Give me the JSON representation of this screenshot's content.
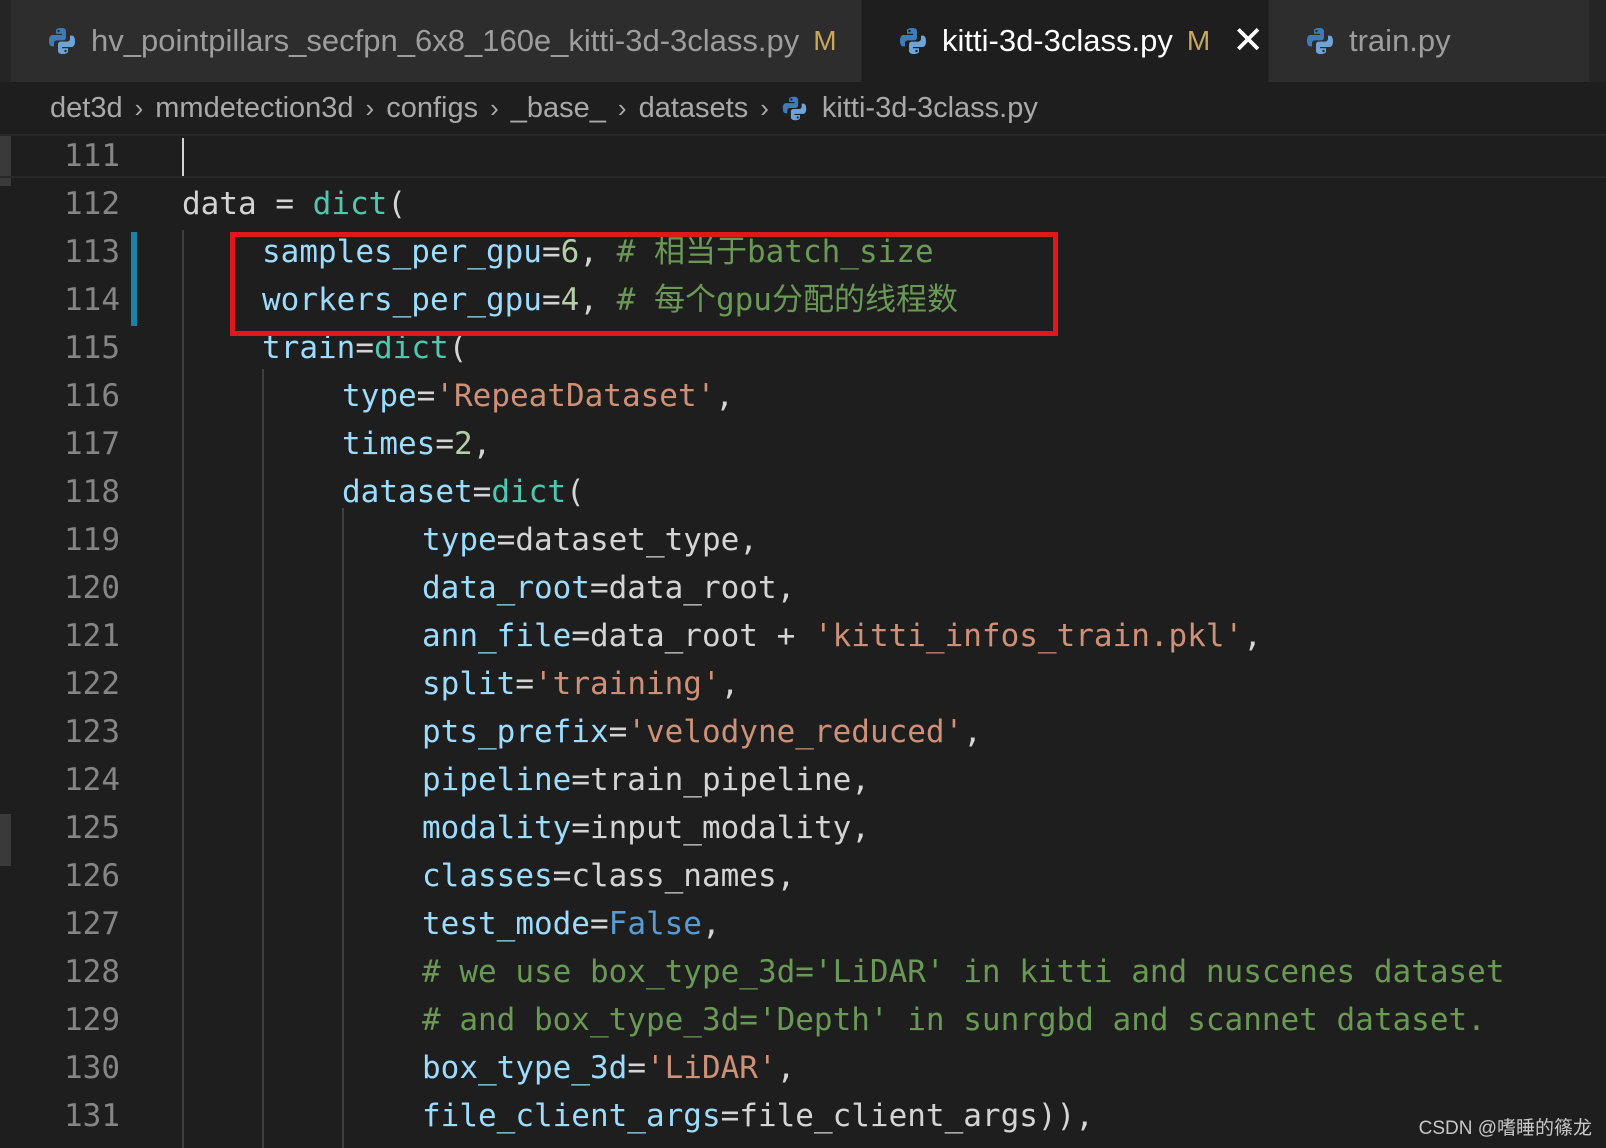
{
  "tabs": [
    {
      "label": "hv_pointpillars_secfpn_6x8_160e_kitti-3d-3class.py",
      "modified": "M",
      "icon": "python-icon"
    },
    {
      "label": "kitti-3d-3class.py",
      "modified": "M",
      "close": "✕",
      "icon": "python-icon"
    },
    {
      "label": "train.py",
      "icon": "python-icon"
    }
  ],
  "breadcrumb": [
    "det3d",
    "mmdetection3d",
    "configs",
    "_base_",
    "datasets",
    "kitti-3d-3class.py"
  ],
  "breadcrumb_separator": "›",
  "editor": {
    "line_numbers": [
      "111",
      "112",
      "113",
      "114",
      "115",
      "116",
      "117",
      "118",
      "119",
      "120",
      "121",
      "122",
      "123",
      "124",
      "125",
      "126",
      "127",
      "128",
      "129",
      "130",
      "131"
    ],
    "code": {
      "l112": {
        "a": "data = ",
        "b": "dict",
        "c": "("
      },
      "l113": {
        "a": "samples_per_gpu",
        "b": "=",
        "c": "6",
        "d": ", ",
        "e": "# 相当于batch_size"
      },
      "l114": {
        "a": "workers_per_gpu",
        "b": "=",
        "c": "4",
        "d": ", ",
        "e": "# 每个gpu分配的线程数"
      },
      "l115": {
        "a": "train",
        "b": "=",
        "c": "dict",
        "d": "("
      },
      "l116": {
        "a": "type",
        "b": "=",
        "c": "'RepeatDataset'",
        "d": ","
      },
      "l117": {
        "a": "times",
        "b": "=",
        "c": "2",
        "d": ","
      },
      "l118": {
        "a": "dataset",
        "b": "=",
        "c": "dict",
        "d": "("
      },
      "l119": {
        "a": "type",
        "b": "=dataset_type,"
      },
      "l120": {
        "a": "data_root",
        "b": "=data_root,"
      },
      "l121": {
        "a": "ann_file",
        "b": "=data_root + ",
        "c": "'kitti_infos_train.pkl'",
        "d": ","
      },
      "l122": {
        "a": "split",
        "b": "=",
        "c": "'training'",
        "d": ","
      },
      "l123": {
        "a": "pts_prefix",
        "b": "=",
        "c": "'velodyne_reduced'",
        "d": ","
      },
      "l124": {
        "a": "pipeline",
        "b": "=train_pipeline,"
      },
      "l125": {
        "a": "modality",
        "b": "=input_modality,"
      },
      "l126": {
        "a": "classes",
        "b": "=class_names,"
      },
      "l127": {
        "a": "test_mode",
        "b": "=",
        "c": "False",
        "d": ","
      },
      "l128": {
        "a": "# we use box_type_3d='LiDAR' in kitti and nuscenes dataset"
      },
      "l129": {
        "a": "# and box_type_3d='Depth' in sunrgbd and scannet dataset."
      },
      "l130": {
        "a": "box_type_3d",
        "b": "=",
        "c": "'LiDAR'",
        "d": ","
      },
      "l131": {
        "a": "file_client_args",
        "b": "=file_client_args)),"
      }
    }
  },
  "highlight_color": "#e0171b",
  "watermark": "CSDN @嗜睡的篠龙"
}
